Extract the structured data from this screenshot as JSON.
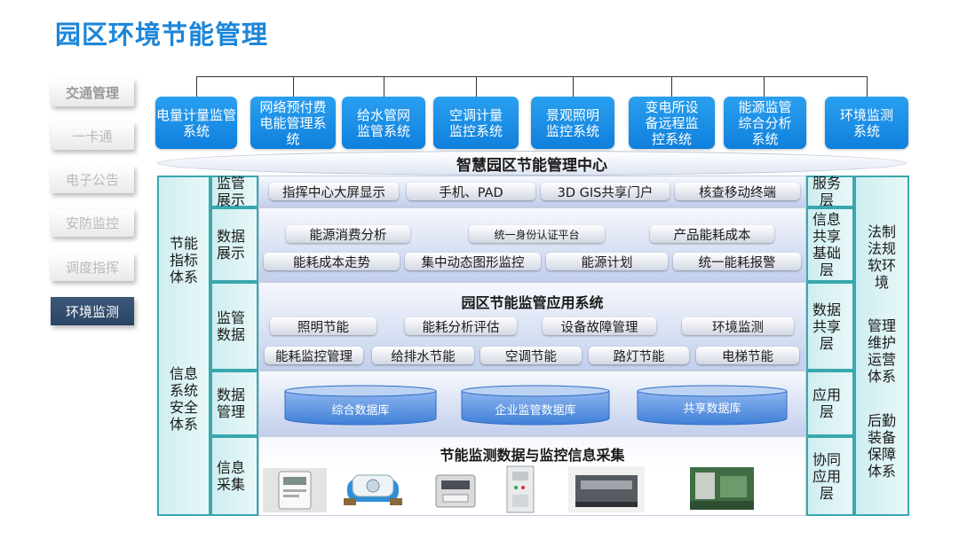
{
  "page_title": "园区环境节能管理",
  "side_nav": [
    {
      "label": "交通管理"
    },
    {
      "label": "一卡通"
    },
    {
      "label": "电子公告"
    },
    {
      "label": "安防监控"
    },
    {
      "label": "调度指挥"
    },
    {
      "label": "环境监测",
      "active": true
    }
  ],
  "top_systems": [
    "电量计量监管系统",
    "网络预付费电能管理系统",
    "给水管网监管系统",
    "空调计量监控系统",
    "景观照明监控系统",
    "变电所设备远程监控系统",
    "能源监管综合分析系统",
    "环境监测系统"
  ],
  "center_title": "智慧园区节能管理中心",
  "left_column": {
    "top": "节能指标体系",
    "bottom": "信息系统安全体系"
  },
  "right_column": {
    "items": [
      "法制法规软环境",
      "管理维护运营体系",
      "后勤装备保障体系"
    ]
  },
  "row_labels": [
    "监管展示",
    "数据展示",
    "监管数据",
    "数据管理",
    "信息采集"
  ],
  "layer_labels": [
    "服务层",
    "信息共享基础层",
    "数据共享层",
    "应用层",
    "协同应用层"
  ],
  "display_row": [
    "指挥中心大屏显示",
    "手机、PAD",
    "3D GIS共享门户",
    "核查移动终端"
  ],
  "data_show": {
    "row1": [
      "能源消费分析",
      "统一身份认证平台",
      "产品能耗成本"
    ],
    "row2": [
      "能耗成本走势",
      "集中动态图形监控",
      "能源计划",
      "统一能耗报警"
    ]
  },
  "app_system": {
    "title": "园区节能监管应用系统",
    "row1": [
      "照明节能",
      "能耗分析评估",
      "设备故障管理",
      "环境监测"
    ],
    "row2": [
      "能耗监控管理",
      "给排水节能",
      "空调节能",
      "路灯节能",
      "电梯节能"
    ]
  },
  "databases": [
    "综合数据库",
    "企业监管数据库",
    "共享数据库"
  ],
  "collection_title": "节能监测数据与监控信息采集",
  "colors": {
    "title": "#1d86d8",
    "top_box": "#1a8fe6",
    "teal_border": "#39a7ae",
    "nav_active": "#33506f"
  }
}
